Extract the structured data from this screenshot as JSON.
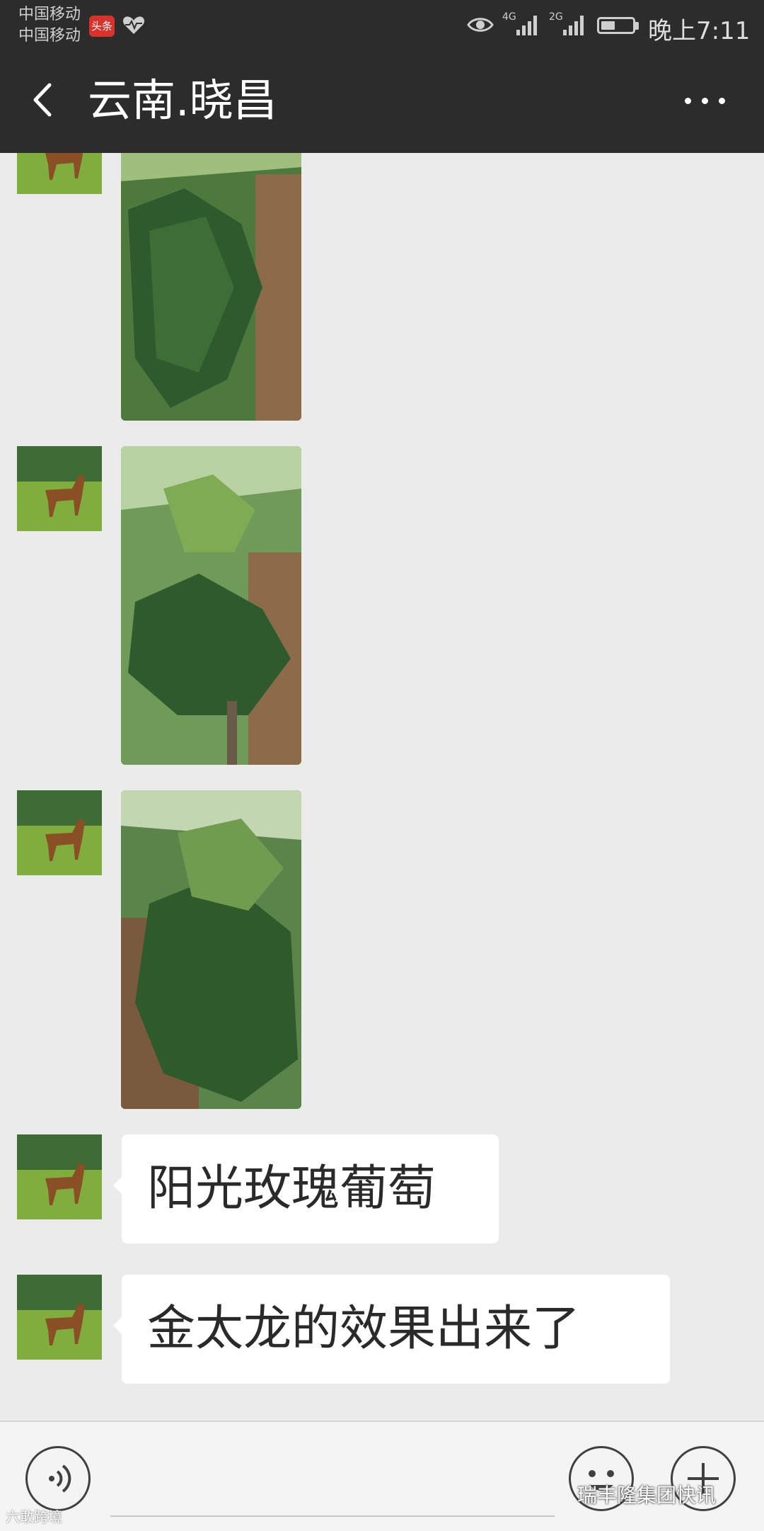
{
  "status_bar": {
    "carrier_1": "中国移动",
    "carrier_2": "中国移动",
    "news_app_label": "头条",
    "network_1": "4G",
    "network_2": "2G",
    "battery_level": 0.45,
    "time": "晚上7:11"
  },
  "header": {
    "title": "云南.晓昌",
    "icons": [
      "back-chevron-icon",
      "more-dots-icon"
    ]
  },
  "messages": [
    {
      "type": "image",
      "description_icon": "grape-vine-photo"
    },
    {
      "type": "image",
      "description_icon": "grape-vine-photo"
    },
    {
      "type": "image",
      "description_icon": "grape-vine-photo"
    },
    {
      "type": "text",
      "text": "阳光玫瑰葡萄"
    },
    {
      "type": "text",
      "text": "金太龙的效果出来了"
    }
  ],
  "input_bar": {
    "icons": [
      "voice-icon",
      "emoji-icon",
      "plus-icon"
    ]
  },
  "watermarks": {
    "right": "瑞丰隆集团快讯",
    "left": "六敢跨境"
  },
  "colors": {
    "bar_dark": "#2c2c2c",
    "chat_bg": "#ebebeb",
    "bubble": "#ffffff"
  }
}
